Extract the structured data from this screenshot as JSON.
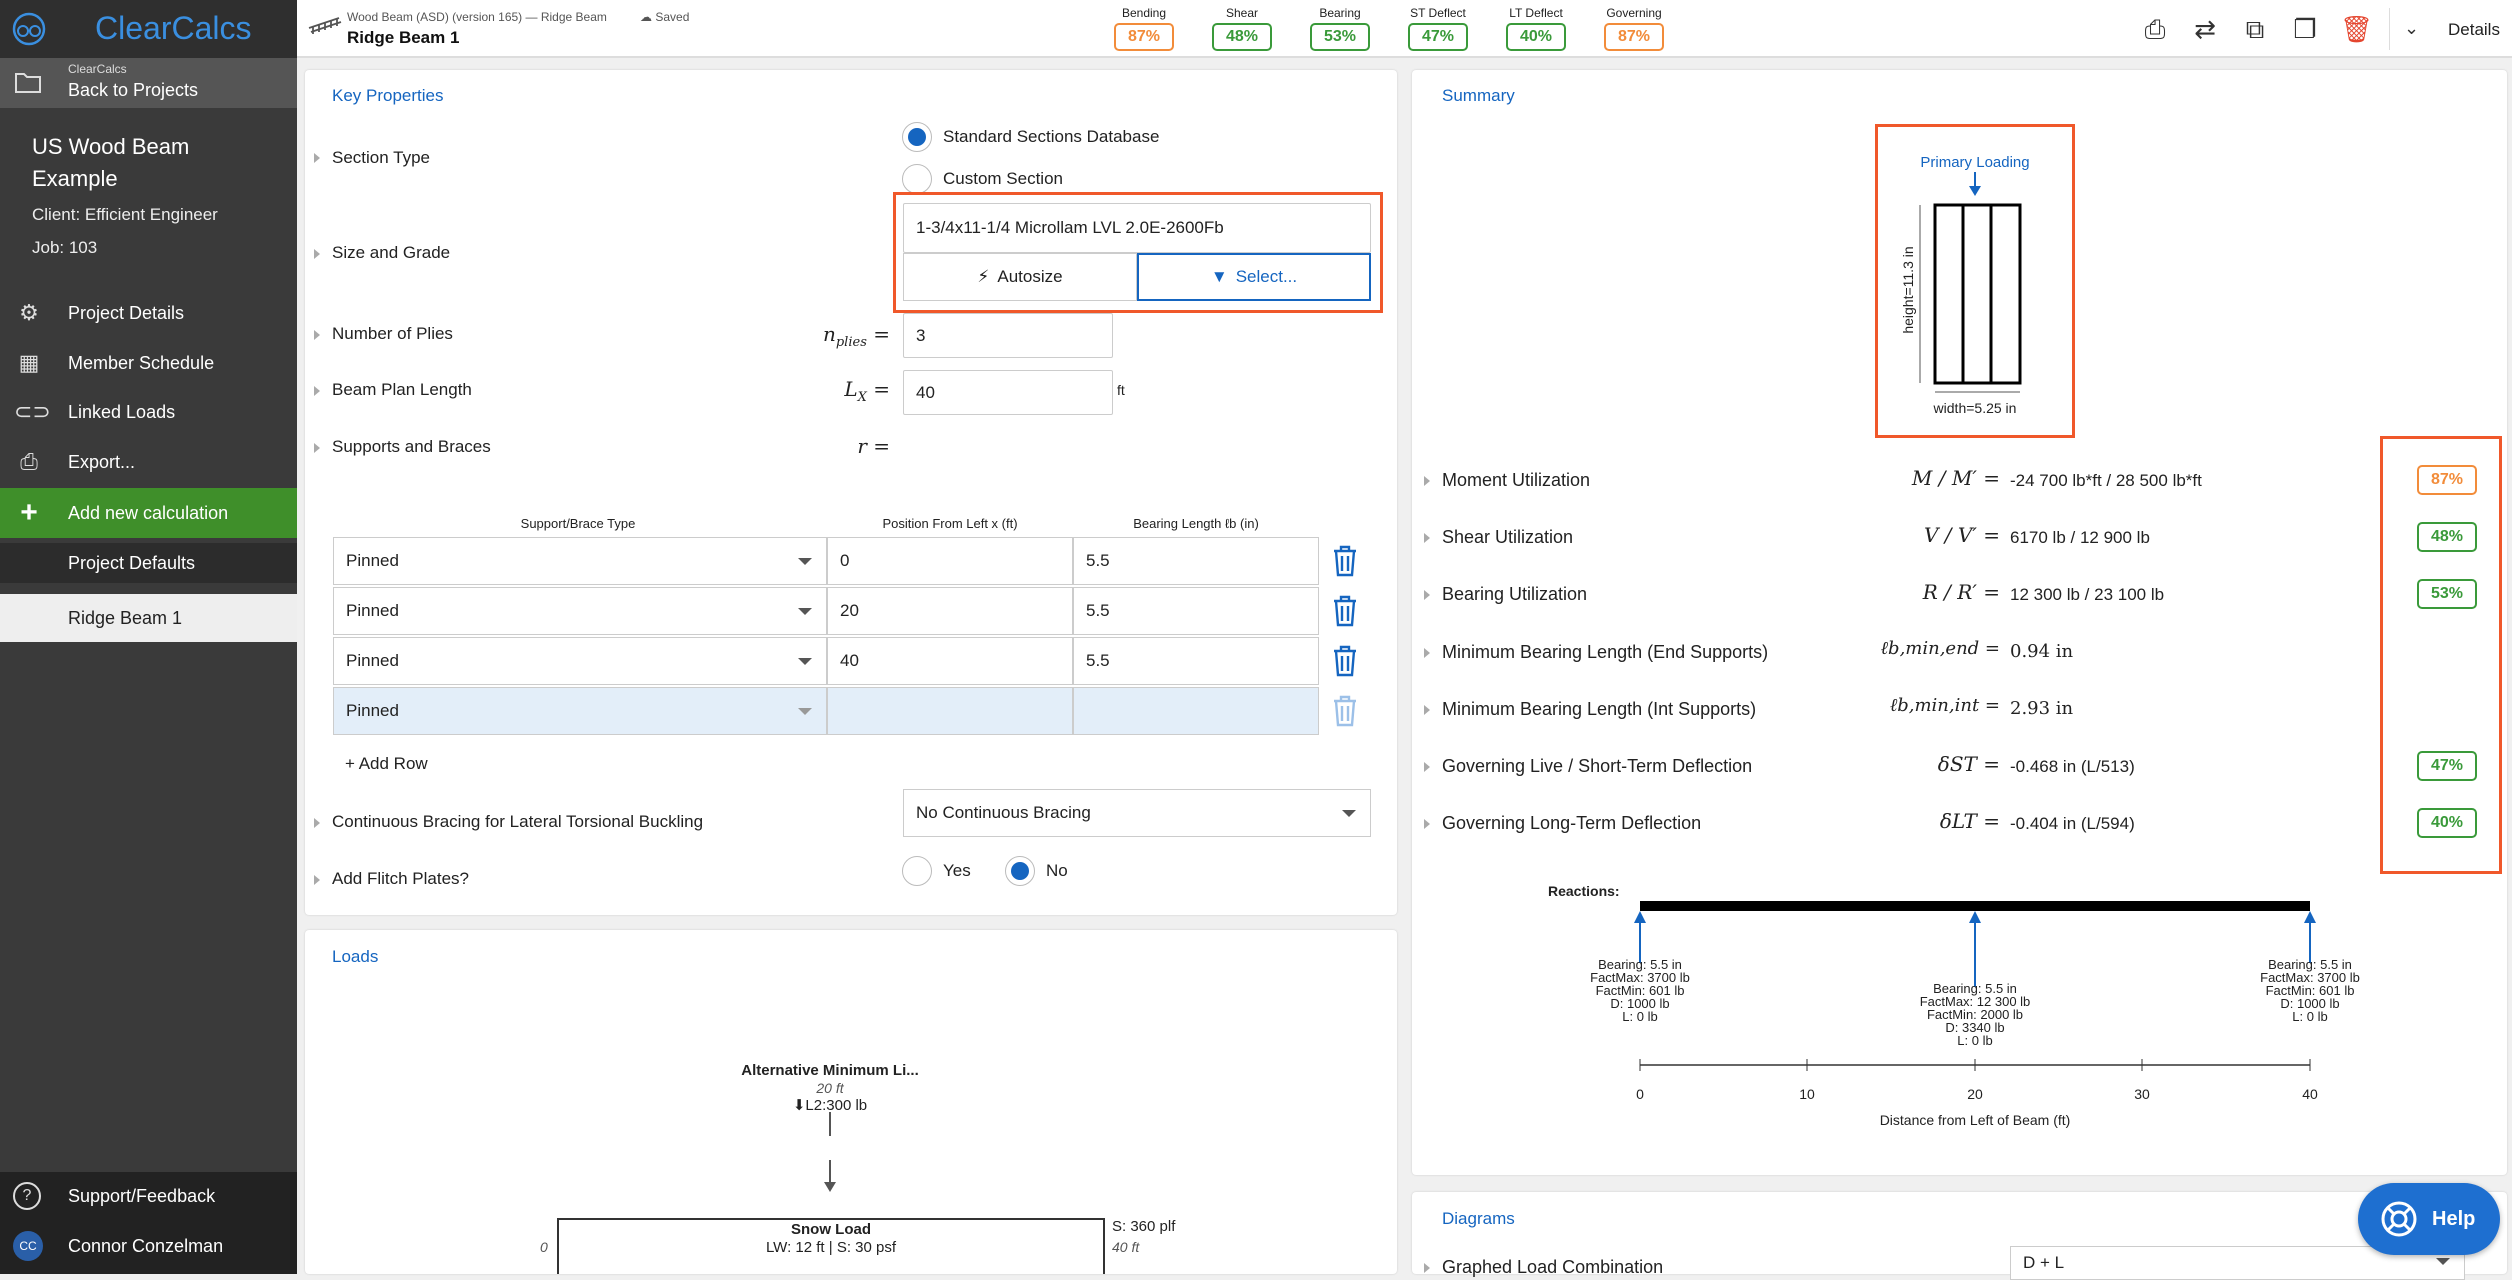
{
  "app": {
    "logo_text": "ClearCalcs"
  },
  "sidebar": {
    "back_sub": "ClearCalcs",
    "back_label": "Back to Projects",
    "project_title_line1": "US Wood Beam",
    "project_title_line2": "Example",
    "client": "Client: Efficient Engineer",
    "job": "Job: 103",
    "items": [
      {
        "label": "Project Details",
        "icon": "gears-icon"
      },
      {
        "label": "Member Schedule",
        "icon": "grid-icon"
      },
      {
        "label": "Linked Loads",
        "icon": "link-icon"
      },
      {
        "label": "Export...",
        "icon": "printer-icon"
      }
    ],
    "add_calc": "Add new calculation",
    "project_defaults": "Project Defaults",
    "current_calc": "Ridge Beam 1",
    "support": "Support/Feedback",
    "user_initials": "CC",
    "user_name": "Connor Conzelman"
  },
  "topbar": {
    "subtitle": "Wood Beam (ASD) (version 165) — Ridge Beam",
    "saved": "Saved",
    "title": "Ridge Beam 1",
    "checks": [
      {
        "label": "Bending",
        "value": "87%",
        "status": "warn"
      },
      {
        "label": "Shear",
        "value": "48%",
        "status": "ok"
      },
      {
        "label": "Bearing",
        "value": "53%",
        "status": "ok"
      },
      {
        "label": "ST Deflect",
        "value": "47%",
        "status": "ok"
      },
      {
        "label": "LT Deflect",
        "value": "40%",
        "status": "ok"
      },
      {
        "label": "Governing",
        "value": "87%",
        "status": "warn"
      }
    ],
    "details": "Details"
  },
  "key_properties": {
    "title": "Key Properties",
    "section_type_label": "Section Type",
    "section_options": [
      "Standard Sections Database",
      "Custom Section"
    ],
    "size_grade_label": "Size and Grade",
    "size_grade_value": "1-3/4x11-1/4 Microllam LVL 2.0E-2600Fb",
    "autosize": "Autosize",
    "select": "Select...",
    "plies_label": "Number of Plies",
    "plies_var": "n",
    "plies_sub": "plies",
    "plies_value": "3",
    "length_label": "Beam Plan Length",
    "length_var": "L",
    "length_sub": "X",
    "length_value": "40",
    "length_unit": "ft",
    "supports_label": "Supports and Braces",
    "supports_var": "r",
    "table_headers": [
      "Support/Brace Type",
      "Position From Left x (ft)",
      "Bearing Length ℓb (in)"
    ],
    "rows": [
      {
        "type": "Pinned",
        "pos": "0",
        "bearing": "5.5"
      },
      {
        "type": "Pinned",
        "pos": "20",
        "bearing": "5.5"
      },
      {
        "type": "Pinned",
        "pos": "40",
        "bearing": "5.5"
      },
      {
        "type": "Pinned",
        "pos": "",
        "bearing": ""
      }
    ],
    "add_row": "+ Add Row",
    "bracing_label": "Continuous Bracing for Lateral Torsional Buckling",
    "bracing_value": "No Continuous Bracing",
    "flitch_label": "Add Flitch Plates?",
    "flitch_yes": "Yes",
    "flitch_no": "No"
  },
  "summary": {
    "title": "Summary",
    "section_diagram": {
      "load_label": "Primary Loading",
      "height_label": "height=11.3 in",
      "width_label": "width=5.25 in"
    },
    "rows": [
      {
        "label": "Moment Utilization",
        "eq": "M / M′ =",
        "value": "-24 700 lb*ft / 28 500 lb*ft",
        "badge": "87%",
        "status": "warn"
      },
      {
        "label": "Shear Utilization",
        "eq": "V / V′ =",
        "value": "6170 lb / 12 900 lb",
        "badge": "48%",
        "status": "ok"
      },
      {
        "label": "Bearing Utilization",
        "eq": "R / R′ =",
        "value": "12 300 lb / 23 100 lb",
        "badge": "53%",
        "status": "ok"
      },
      {
        "label": "Minimum Bearing Length (End Supports)",
        "eq": "ℓb,min,end =",
        "value": "0.94 in",
        "badge": "",
        "status": ""
      },
      {
        "label": "Minimum Bearing Length (Int Supports)",
        "eq": "ℓb,min,int =",
        "value": "2.93 in",
        "badge": "",
        "status": ""
      },
      {
        "label": "Governing Live / Short-Term Deflection",
        "eq": "δST =",
        "value": "-0.468 in (L/513)",
        "badge": "47%",
        "status": "ok"
      },
      {
        "label": "Governing Long-Term Deflection",
        "eq": "δLT =",
        "value": "-0.404 in (L/594)",
        "badge": "40%",
        "status": "ok"
      }
    ],
    "reactions": {
      "title": "Reactions:",
      "supports": [
        {
          "x": 0,
          "lines": [
            "Bearing: 5.5 in",
            "FactMax: 3700 lb",
            "FactMin: 601 lb",
            "D: 1000 lb",
            "L: 0 lb"
          ]
        },
        {
          "x": 20,
          "lines": [
            "Bearing: 5.5 in",
            "FactMax: 12 300 lb",
            "FactMin: 2000 lb",
            "D: 3340 lb",
            "L: 0 lb"
          ]
        },
        {
          "x": 40,
          "lines": [
            "Bearing: 5.5 in",
            "FactMax: 3700 lb",
            "FactMin: 601 lb",
            "D: 1000 lb",
            "L: 0 lb"
          ]
        }
      ],
      "ticks": [
        "0",
        "10",
        "20",
        "30",
        "40"
      ],
      "axis_label": "Distance from Left of Beam (ft)"
    }
  },
  "loads": {
    "title": "Loads",
    "point_load_title": "Alternative Minimum Li...",
    "point_load_pos": "20 ft",
    "point_load_value": "L2:300 lb",
    "dist_title": "Snow Load",
    "dist_sub": "LW: 12 ft | S: 30 psf",
    "dist_right": "S: 360 plf",
    "dist_start": "0",
    "dist_end": "40 ft"
  },
  "diagrams": {
    "title": "Diagrams",
    "row_label": "Graphed Load Combination",
    "row_value": "D + L"
  },
  "help": "Help"
}
